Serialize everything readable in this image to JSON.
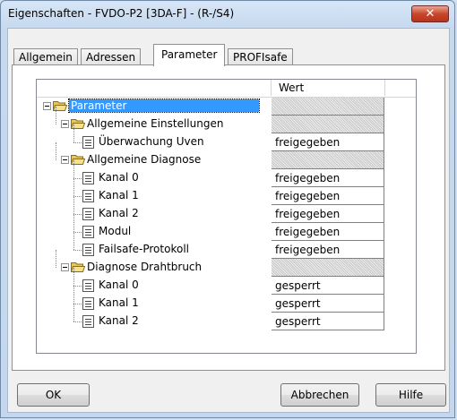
{
  "window": {
    "title": "Eigenschaften - FVDO-P2 [3DA-F] - (R-/S4)",
    "close_label": "✕"
  },
  "tabs": [
    {
      "label": "Allgemein"
    },
    {
      "label": "Adressen"
    },
    {
      "label": "Parameter",
      "active": true
    },
    {
      "label": "PROFIsafe"
    }
  ],
  "table": {
    "value_header": "Wert",
    "rows": [
      {
        "label": "Parameter",
        "type": "folder",
        "value": ""
      },
      {
        "label": "Allgemeine Einstellungen",
        "type": "folder",
        "value": ""
      },
      {
        "label": "Überwachung Uven",
        "type": "param",
        "value": "freigegeben"
      },
      {
        "label": "Allgemeine Diagnose",
        "type": "folder",
        "value": ""
      },
      {
        "label": "Kanal 0",
        "type": "param",
        "value": "freigegeben"
      },
      {
        "label": "Kanal 1",
        "type": "param",
        "value": "freigegeben"
      },
      {
        "label": "Kanal 2",
        "type": "param",
        "value": "freigegeben"
      },
      {
        "label": "Modul",
        "type": "param",
        "value": "freigegeben"
      },
      {
        "label": "Failsafe-Protokoll",
        "type": "param",
        "value": "freigegeben"
      },
      {
        "label": "Diagnose Drahtbruch",
        "type": "folder",
        "value": ""
      },
      {
        "label": "Kanal 0",
        "type": "param",
        "value": "gesperrt"
      },
      {
        "label": "Kanal 1",
        "type": "param",
        "value": "gesperrt"
      },
      {
        "label": "Kanal 2",
        "type": "param",
        "value": "gesperrt"
      }
    ]
  },
  "buttons": {
    "ok": "OK",
    "cancel": "Abbrechen",
    "help": "Hilfe"
  },
  "colors": {
    "selection": "#3399ff",
    "close_button": "#c9472c"
  }
}
